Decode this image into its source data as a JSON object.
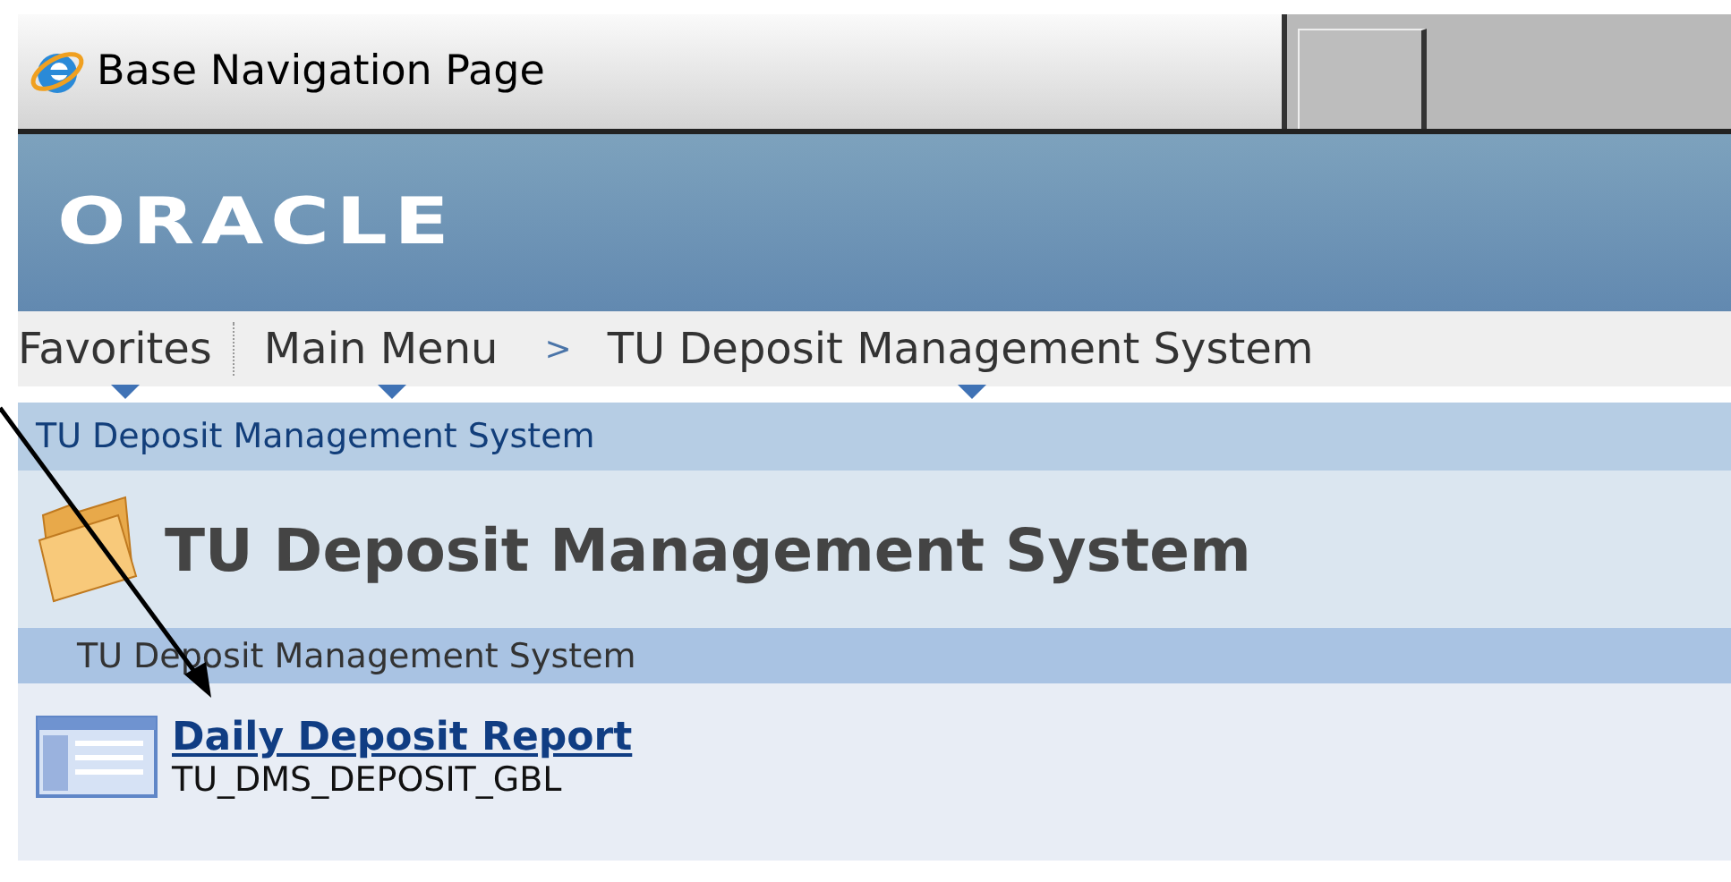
{
  "browser_tab": {
    "title": "Base Navigation Page"
  },
  "logo": "ORACLE",
  "menu": [
    {
      "label": "Favorites",
      "has_dropdown": true
    },
    {
      "label": "Main Menu",
      "has_dropdown": true
    },
    {
      "label": "TU Deposit Management System",
      "has_dropdown": true
    }
  ],
  "menu_separator": ">",
  "breadcrumb": "TU Deposit Management System",
  "page_title": "TU Deposit Management System",
  "section_title": "TU Deposit Management System",
  "items": [
    {
      "title": "Daily Deposit Report",
      "code": "TU_DMS_DEPOSIT_GBL"
    }
  ]
}
